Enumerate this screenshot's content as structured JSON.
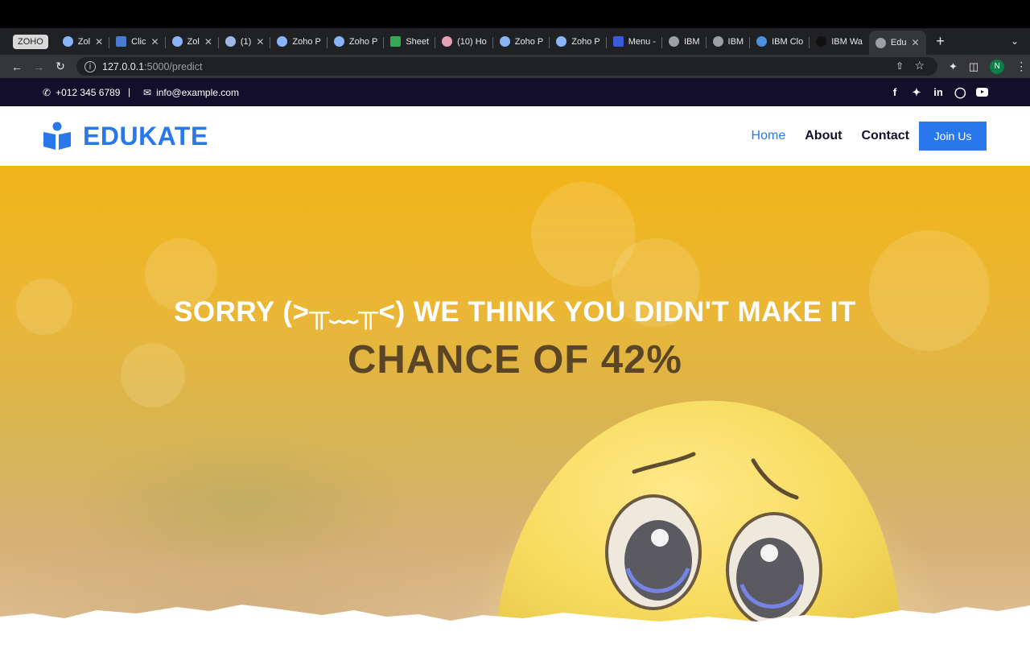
{
  "browser": {
    "zoho_badge": "ZOHO",
    "tabs": [
      {
        "label": "Zol",
        "close": "✕"
      },
      {
        "label": "Clic",
        "close": "✕"
      },
      {
        "label": "Zol",
        "close": "✕"
      },
      {
        "label": "(1)",
        "close": "✕"
      },
      {
        "label": "Zoho P"
      },
      {
        "label": "Zoho P"
      },
      {
        "label": "Sheet"
      },
      {
        "label": "(10) Ho"
      },
      {
        "label": "Zoho P"
      },
      {
        "label": "Zoho P"
      },
      {
        "label": "Menu -"
      },
      {
        "label": "IBM"
      },
      {
        "label": "IBM"
      },
      {
        "label": "IBM Clo"
      },
      {
        "label": "IBM Wa"
      },
      {
        "label": "Edu",
        "close": "✕"
      }
    ],
    "new_tab": "+",
    "url_host": "127.0.0.1",
    "url_path": ":5000/predict",
    "profile_initial": "N"
  },
  "topbar": {
    "phone": "+012 345 6789",
    "separator": "|",
    "email": "info@example.com"
  },
  "brand": {
    "name": "EDUKATE"
  },
  "nav": {
    "home": "Home",
    "about": "About",
    "contact": "Contact",
    "join": "Join Us"
  },
  "hero": {
    "title": "SORRY (>╥﹏╥<) WE THINK YOU DIDN'T MAKE IT",
    "subtitle": "CHANCE OF 42%"
  },
  "colors": {
    "primary": "#2878eb",
    "dark": "#130f2a",
    "hero_yellow": "#f2b418"
  }
}
